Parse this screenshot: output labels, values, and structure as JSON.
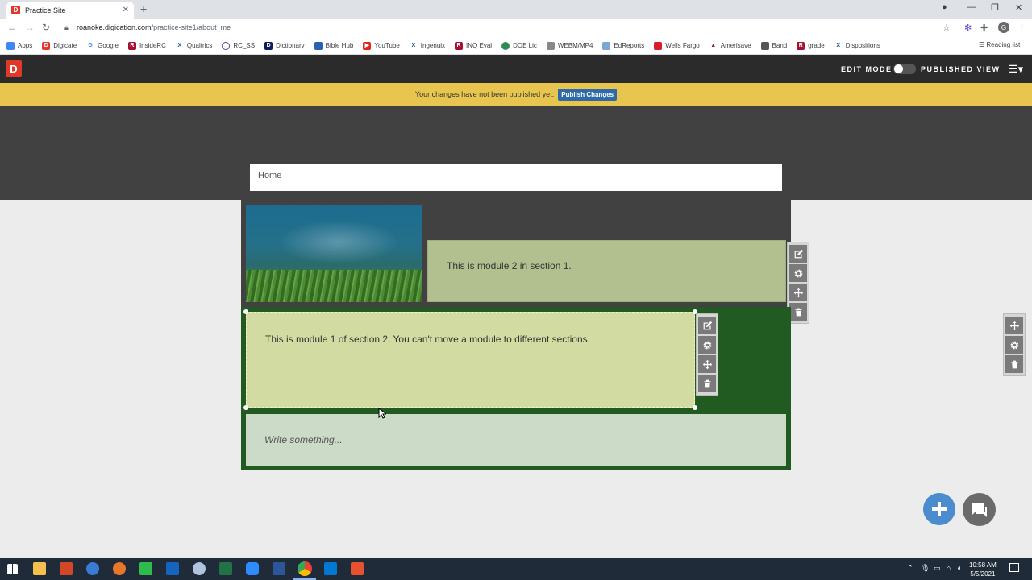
{
  "browser": {
    "tab_title": "Practice Site",
    "new_tab": "+",
    "url_host": "roanoke.digication.com",
    "url_path": "/practice-site1/about_me",
    "bookmarks": [
      "Apps",
      "Digicate",
      "Google",
      "InsideRC",
      "Qualtrics",
      "RC_SS",
      "Dictionary",
      "Bible Hub",
      "YouTube",
      "Ingenuix",
      "INQ Eval",
      "DOE Lic",
      "WEBM/MP4",
      "EdReports",
      "Wells Fargo",
      "Amerisave",
      "Band",
      "grade",
      "Dispositions"
    ],
    "reading_list": "Reading list",
    "profile_initial": "G"
  },
  "app": {
    "logo": "D",
    "edit_mode": "EDIT MODE",
    "published_view": "PUBLISHED VIEW"
  },
  "notice": {
    "text": "Your changes have not been published yet.",
    "publish_button": "Publish Changes"
  },
  "page": {
    "breadcrumb": "Home",
    "module2_text": "This is module 2 in section 1.",
    "module1_text": "This is module 1 of section 2. You can't move a module to different sections.",
    "module3_placeholder": "Write something..."
  },
  "taskbar": {
    "time": "10:58 AM",
    "date": "5/5/2021"
  },
  "colors": {
    "notice_bg": "#e8c54e",
    "section2_bg": "#215b22",
    "publish_btn": "#2f6aa8"
  }
}
